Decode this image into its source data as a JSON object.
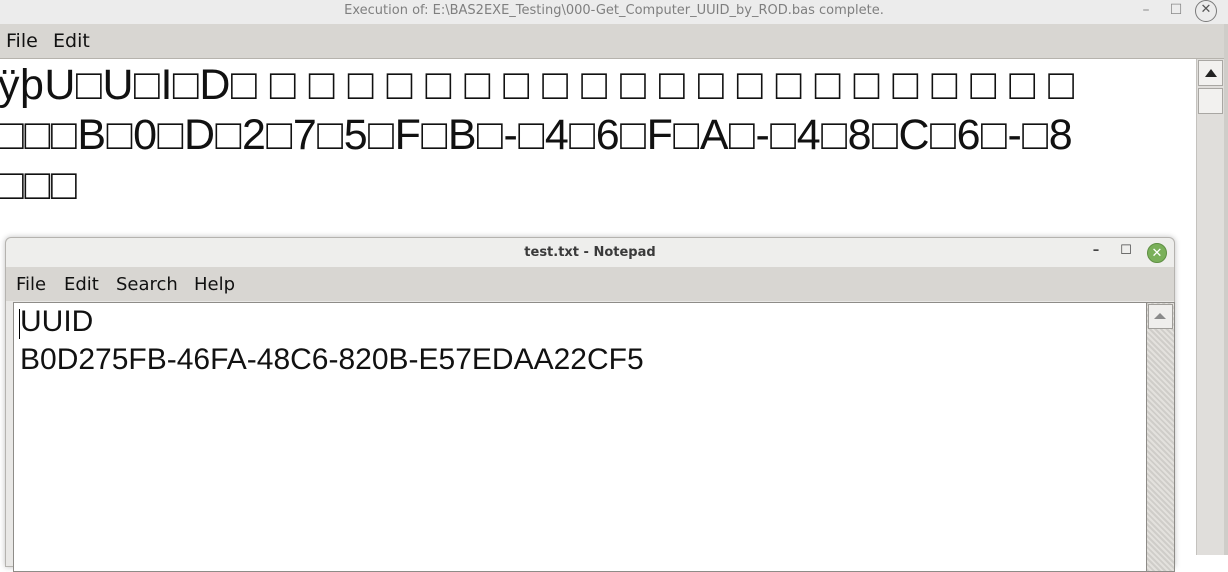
{
  "outer_window": {
    "title": "Execution of: E:\\BAS2EXE_Testing\\000-Get_Computer_UUID_by_ROD.bas complete.",
    "controls": {
      "minimize": "–",
      "maximize": "☐",
      "close": "✕"
    },
    "menu": {
      "file": "File",
      "edit": "Edit"
    },
    "console_lines": [
      "ÿþU□U□I□D□ □ □ □ □ □ □ □ □ □ □ □ □ □ □ □ □ □ □ □ □ □",
      "□□□B□0□D□2□7□5□F□B□-□4□6□F□A□-□4□8□C□6□-□8",
      "□□□"
    ]
  },
  "notepad": {
    "title": "test.txt - Notepad",
    "controls": {
      "minimize": "–",
      "maximize": "☐",
      "close": "✕"
    },
    "menu": {
      "file": "File",
      "edit": "Edit",
      "search": "Search",
      "help": "Help"
    },
    "lines": [
      "UUID",
      "B0D275FB-46FA-48C6-820B-E57EDAA22CF5"
    ]
  }
}
